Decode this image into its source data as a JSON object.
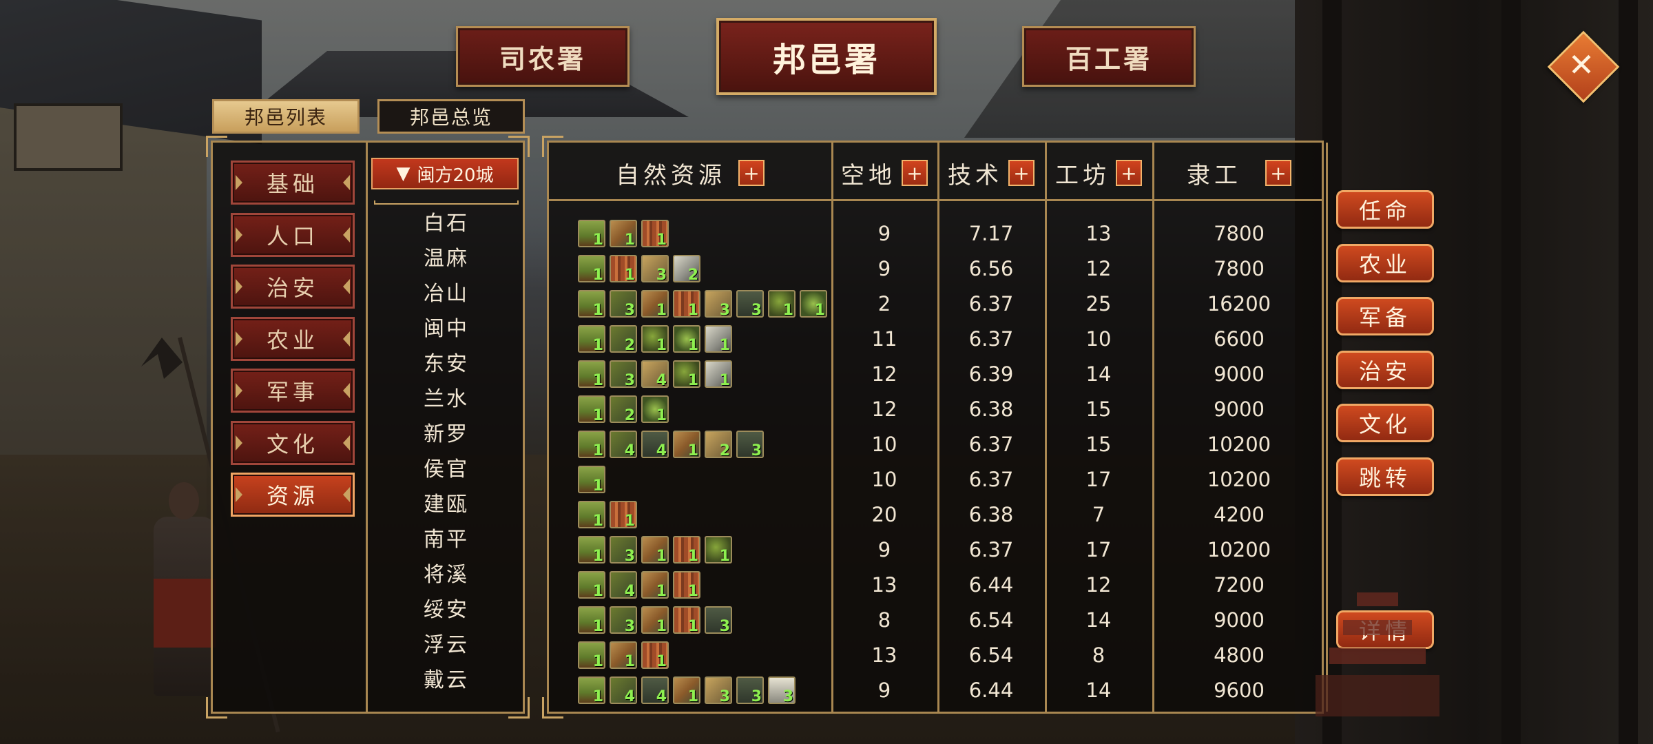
{
  "top_tabs": {
    "left": "司农署",
    "center": "邦邑署",
    "right": "百工署"
  },
  "close_label": "✕",
  "sub_tabs": {
    "list": "邦邑列表",
    "overview": "邦邑总览"
  },
  "menu": [
    "基础",
    "人口",
    "治安",
    "农业",
    "军事",
    "文化",
    "资源"
  ],
  "active_menu": "资源",
  "region": {
    "arrow": "▼",
    "label": "闽方20城"
  },
  "columns": {
    "resources": "自然资源",
    "land": "空地",
    "tech": "技术",
    "workshop": "工坊",
    "laborers": "隶工",
    "plus": "+"
  },
  "rows": [
    {
      "city": "白石",
      "land": "9",
      "tech": "7.17",
      "workshop": "13",
      "laborers": "7800",
      "res": [
        [
          "tree",
          "1"
        ],
        [
          "axe",
          "1"
        ],
        [
          "bamboo",
          "1"
        ]
      ]
    },
    {
      "city": "温麻",
      "land": "9",
      "tech": "6.56",
      "workshop": "12",
      "laborers": "7800",
      "res": [
        [
          "tree",
          "1"
        ],
        [
          "bamboo",
          "1"
        ],
        [
          "pick",
          "3"
        ],
        [
          "stone",
          "2"
        ]
      ]
    },
    {
      "city": "冶山",
      "land": "2",
      "tech": "6.37",
      "workshop": "25",
      "laborers": "16200",
      "res": [
        [
          "tree",
          "1"
        ],
        [
          "sickle",
          "3"
        ],
        [
          "axe",
          "1"
        ],
        [
          "bamboo",
          "1"
        ],
        [
          "pick",
          "3"
        ],
        [
          "stairs",
          "3"
        ],
        [
          "grain",
          "1"
        ],
        [
          "leaf",
          "1"
        ]
      ]
    },
    {
      "city": "闽中",
      "land": "11",
      "tech": "6.37",
      "workshop": "10",
      "laborers": "6600",
      "res": [
        [
          "tree",
          "1"
        ],
        [
          "sickle",
          "2"
        ],
        [
          "grain",
          "1"
        ],
        [
          "leaf",
          "1"
        ],
        [
          "stone",
          "1"
        ]
      ]
    },
    {
      "city": "东安",
      "land": "12",
      "tech": "6.39",
      "workshop": "14",
      "laborers": "9000",
      "res": [
        [
          "tree",
          "1"
        ],
        [
          "sickle",
          "3"
        ],
        [
          "pick",
          "4"
        ],
        [
          "grain",
          "1"
        ],
        [
          "stone",
          "1"
        ]
      ]
    },
    {
      "city": "兰水",
      "land": "12",
      "tech": "6.38",
      "workshop": "15",
      "laborers": "9000",
      "res": [
        [
          "tree",
          "1"
        ],
        [
          "sickle",
          "2"
        ],
        [
          "leaf",
          "1"
        ]
      ]
    },
    {
      "city": "新罗",
      "land": "10",
      "tech": "6.37",
      "workshop": "15",
      "laborers": "10200",
      "res": [
        [
          "tree",
          "1"
        ],
        [
          "sickle",
          "4"
        ],
        [
          "stairs",
          "4"
        ],
        [
          "axe",
          "1"
        ],
        [
          "pick",
          "2"
        ],
        [
          "stairs",
          "3"
        ]
      ]
    },
    {
      "city": "侯官",
      "land": "10",
      "tech": "6.37",
      "workshop": "17",
      "laborers": "10200",
      "res": [
        [
          "tree",
          "1"
        ]
      ]
    },
    {
      "city": "建瓯",
      "land": "20",
      "tech": "6.38",
      "workshop": "7",
      "laborers": "4200",
      "res": [
        [
          "tree",
          "1"
        ],
        [
          "bamboo",
          "1"
        ]
      ]
    },
    {
      "city": "南平",
      "land": "9",
      "tech": "6.37",
      "workshop": "17",
      "laborers": "10200",
      "res": [
        [
          "tree",
          "1"
        ],
        [
          "sickle",
          "3"
        ],
        [
          "axe",
          "1"
        ],
        [
          "bamboo",
          "1"
        ],
        [
          "grain",
          "1"
        ]
      ]
    },
    {
      "city": "将溪",
      "land": "13",
      "tech": "6.44",
      "workshop": "12",
      "laborers": "7200",
      "res": [
        [
          "tree",
          "1"
        ],
        [
          "sickle",
          "4"
        ],
        [
          "axe",
          "1"
        ],
        [
          "bamboo",
          "1"
        ]
      ]
    },
    {
      "city": "绥安",
      "land": "8",
      "tech": "6.54",
      "workshop": "14",
      "laborers": "9000",
      "res": [
        [
          "tree",
          "1"
        ],
        [
          "sickle",
          "3"
        ],
        [
          "axe",
          "1"
        ],
        [
          "bamboo",
          "1"
        ],
        [
          "stairs",
          "3"
        ]
      ]
    },
    {
      "city": "浮云",
      "land": "13",
      "tech": "6.54",
      "workshop": "8",
      "laborers": "4800",
      "res": [
        [
          "tree",
          "1"
        ],
        [
          "axe",
          "1"
        ],
        [
          "bamboo",
          "1"
        ]
      ]
    },
    {
      "city": "戴云",
      "land": "9",
      "tech": "6.44",
      "workshop": "14",
      "laborers": "9600",
      "res": [
        [
          "tree",
          "1"
        ],
        [
          "sickle",
          "4"
        ],
        [
          "stairs",
          "4"
        ],
        [
          "axe",
          "1"
        ],
        [
          "pick",
          "3"
        ],
        [
          "stairs",
          "3"
        ],
        [
          "wave",
          "3"
        ]
      ]
    }
  ],
  "right_buttons": [
    "任命",
    "农业",
    "军备",
    "治安",
    "文化",
    "跳转"
  ],
  "detail_button": "详情"
}
